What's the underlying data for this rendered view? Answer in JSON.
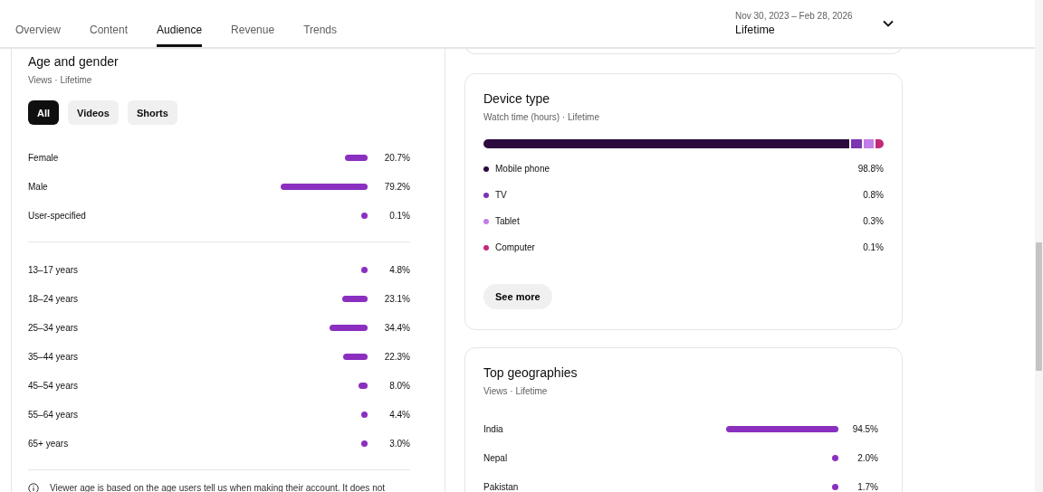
{
  "tabs": [
    {
      "label": "Overview",
      "selected": false
    },
    {
      "label": "Content",
      "selected": false
    },
    {
      "label": "Audience",
      "selected": true
    },
    {
      "label": "Revenue",
      "selected": false
    },
    {
      "label": "Trends",
      "selected": false
    }
  ],
  "date_range": {
    "range": "Nov 30, 2023 – Feb 28, 2026",
    "period": "Lifetime"
  },
  "age_and_gender": {
    "title": "Age and gender",
    "subtitle": "Views · Lifetime",
    "filters": [
      {
        "label": "All",
        "selected": true
      },
      {
        "label": "Videos",
        "selected": false
      },
      {
        "label": "Shorts",
        "selected": false
      }
    ],
    "gender": [
      {
        "label": "Female",
        "value": "20.7%"
      },
      {
        "label": "Male",
        "value": "79.2%"
      },
      {
        "label": "User-specified",
        "value": "0.1%"
      }
    ],
    "age": [
      {
        "label": "13–17 years",
        "value": "4.8%"
      },
      {
        "label": "18–24 years",
        "value": "23.1%"
      },
      {
        "label": "25–34 years",
        "value": "34.4%"
      },
      {
        "label": "35–44 years",
        "value": "22.3%"
      },
      {
        "label": "45–54 years",
        "value": "8.0%"
      },
      {
        "label": "55–64 years",
        "value": "4.4%"
      },
      {
        "label": "65+ years",
        "value": "3.0%"
      }
    ],
    "note": "Viewer age is based on the age users tell us when making their account. It does not"
  },
  "device_type": {
    "title": "Device type",
    "subtitle": "Watch time (hours) · Lifetime",
    "devices": [
      {
        "label": "Mobile phone",
        "value": "98.8%",
        "color": "#2b0a3d"
      },
      {
        "label": "TV",
        "value": "0.8%",
        "color": "#7b35b0"
      },
      {
        "label": "Tablet",
        "value": "0.3%",
        "color": "#c07ee6"
      },
      {
        "label": "Computer",
        "value": "0.1%",
        "color": "#c2297a"
      }
    ],
    "button": "See more"
  },
  "top_geographies": {
    "title": "Top geographies",
    "subtitle": "Views · Lifetime",
    "rows": [
      {
        "label": "India",
        "value": "94.5%"
      },
      {
        "label": "Nepal",
        "value": "2.0%"
      },
      {
        "label": "Pakistan",
        "value": "1.7%"
      }
    ]
  }
}
